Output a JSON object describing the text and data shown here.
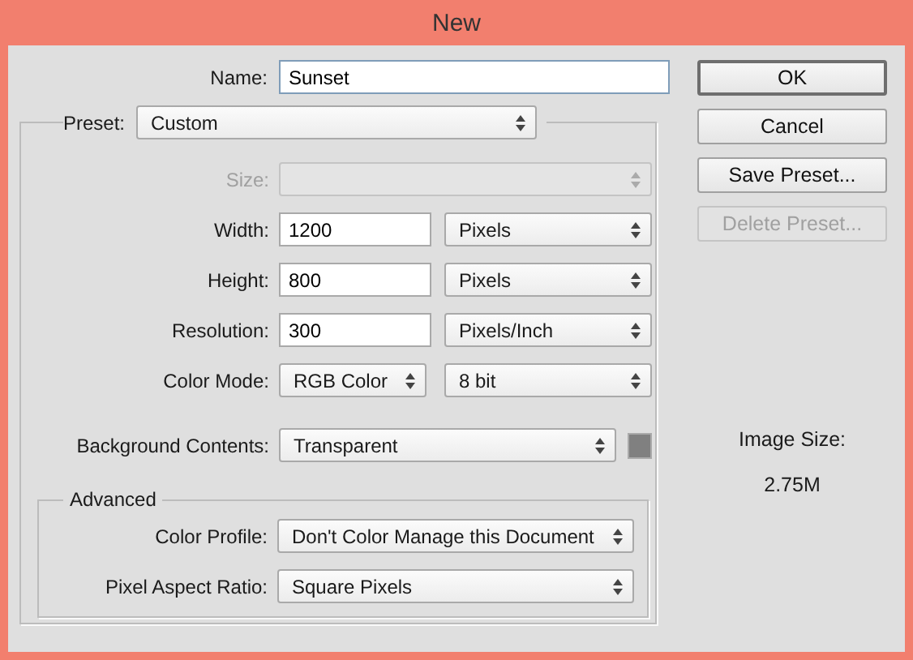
{
  "window": {
    "title": "New"
  },
  "name": {
    "label": "Name:",
    "value": "Sunset"
  },
  "preset": {
    "label": "Preset:",
    "value": "Custom"
  },
  "rows": [
    {
      "label": "Size:",
      "disabled": true,
      "controls": [
        {
          "kind": "select"
        }
      ]
    },
    {
      "label": "Width:",
      "disabled": false,
      "controls": [
        {
          "kind": "input",
          "value": "1200"
        },
        {
          "kind": "select",
          "value": "Pixels"
        }
      ]
    },
    {
      "label": "Height:",
      "disabled": false,
      "controls": [
        {
          "kind": "input",
          "value": "800"
        },
        {
          "kind": "select",
          "value": "Pixels"
        }
      ]
    },
    {
      "label": "Resolution:",
      "disabled": false,
      "controls": [
        {
          "kind": "input",
          "value": "300"
        },
        {
          "kind": "select",
          "value": "Pixels/Inch"
        }
      ]
    },
    {
      "label": "Color Mode:",
      "disabled": false,
      "controls": [
        {
          "kind": "select",
          "value": "RGB Color"
        },
        {
          "kind": "select",
          "value": "8 bit"
        }
      ]
    },
    {
      "label": "Background Contents:",
      "disabled": false,
      "controls": [
        {
          "kind": "select",
          "value": "Transparent"
        },
        {
          "kind": "swatch",
          "color": "#808080"
        }
      ]
    }
  ],
  "advanced": {
    "title": "Advanced",
    "rows": [
      {
        "label": "Color Profile:",
        "disabled": false,
        "controls": [
          {
            "kind": "select",
            "value": "Don't Color Manage this Document"
          }
        ]
      },
      {
        "label": "Pixel Aspect Ratio:",
        "disabled": false,
        "controls": [
          {
            "kind": "select",
            "value": "Square Pixels"
          }
        ]
      }
    ]
  },
  "buttons": [
    {
      "label": "OK",
      "default": true,
      "disabled": false
    },
    {
      "label": "Cancel",
      "default": false,
      "disabled": false
    },
    {
      "label": "Save Preset...",
      "default": false,
      "disabled": false
    },
    {
      "label": "Delete Preset...",
      "default": false,
      "disabled": true
    }
  ],
  "image_size": {
    "label": "Image Size:",
    "value": "2.75M"
  }
}
